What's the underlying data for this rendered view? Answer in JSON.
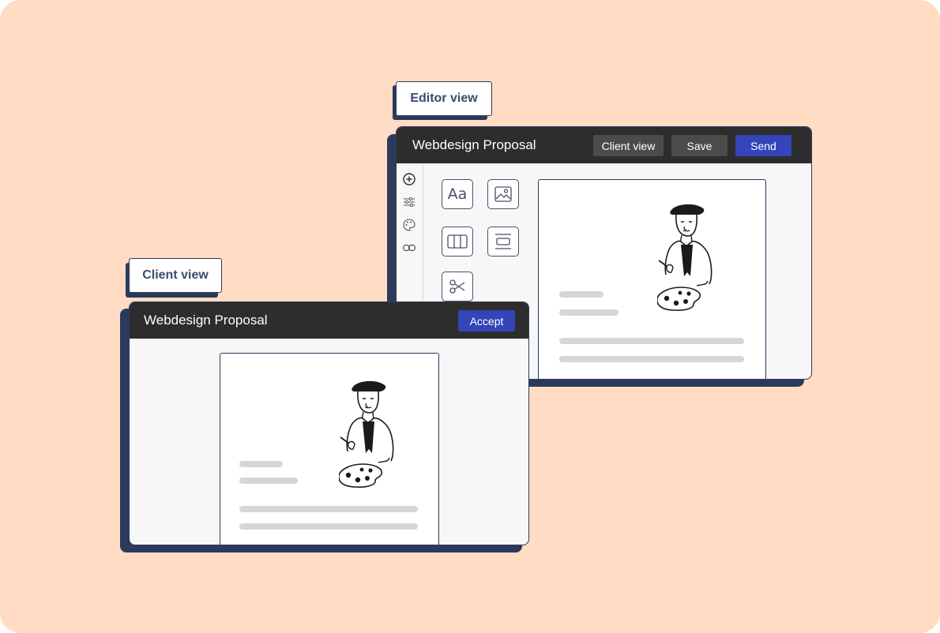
{
  "editor": {
    "tag_label": "Editor view",
    "title": "Webdesign Proposal",
    "buttons": {
      "client_view": "Client view",
      "save": "Save",
      "send": "Send"
    },
    "tools": {
      "text": "Aa"
    },
    "rail_icons": [
      "add-icon",
      "sliders-icon",
      "palette-icon",
      "link-icon"
    ],
    "tool_icons": [
      "text-tool-icon",
      "image-tool-icon",
      "columns-tool-icon",
      "layout-tool-icon",
      "scissors-tool-icon"
    ]
  },
  "client": {
    "tag_label": "Client view",
    "title": "Webdesign Proposal",
    "buttons": {
      "accept": "Accept"
    }
  },
  "colors": {
    "background": "#ffdcc3",
    "navy": "#2b3a5c",
    "titlebar": "#2d2d2d",
    "accent_blue": "#3345b8",
    "dark_button": "#4b4b4b"
  }
}
